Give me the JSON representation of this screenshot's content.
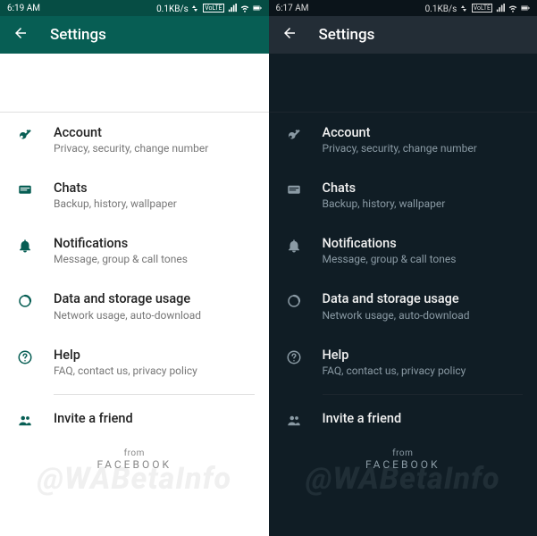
{
  "light": {
    "status": {
      "time": "6:19 AM",
      "net": "0.1KB/s",
      "volte": "VoLTE"
    },
    "header": {
      "title": "Settings"
    },
    "items": [
      {
        "label": "Account",
        "sub": "Privacy, security, change number"
      },
      {
        "label": "Chats",
        "sub": "Backup, history, wallpaper"
      },
      {
        "label": "Notifications",
        "sub": "Message, group & call tones"
      },
      {
        "label": "Data and storage usage",
        "sub": "Network usage, auto-download"
      },
      {
        "label": "Help",
        "sub": "FAQ, contact us, privacy policy"
      },
      {
        "label": "Invite a friend",
        "sub": ""
      }
    ],
    "footer": {
      "from": "from",
      "brand": "FACEBOOK"
    },
    "watermark": "@WABetaInfo"
  },
  "dark": {
    "status": {
      "time": "6:17 AM",
      "net": "0.1KB/s",
      "volte": "VoLTE"
    },
    "header": {
      "title": "Settings"
    },
    "items": [
      {
        "label": "Account",
        "sub": "Privacy, security, change number"
      },
      {
        "label": "Chats",
        "sub": "Backup, history, wallpaper"
      },
      {
        "label": "Notifications",
        "sub": "Message, group & call tones"
      },
      {
        "label": "Data and storage usage",
        "sub": "Network usage, auto-download"
      },
      {
        "label": "Help",
        "sub": "FAQ, contact us, privacy policy"
      },
      {
        "label": "Invite a friend",
        "sub": ""
      }
    ],
    "footer": {
      "from": "from",
      "brand": "FACEBOOK"
    },
    "watermark": "@WABetaInfo"
  },
  "icons": {
    "signal": "signal-icon",
    "wifi": "wifi-icon",
    "battery": "battery-icon",
    "back": "back-icon",
    "key": "key-icon",
    "chat": "chat-icon",
    "bell": "bell-icon",
    "data": "data-icon",
    "help": "help-icon",
    "people": "people-icon"
  }
}
